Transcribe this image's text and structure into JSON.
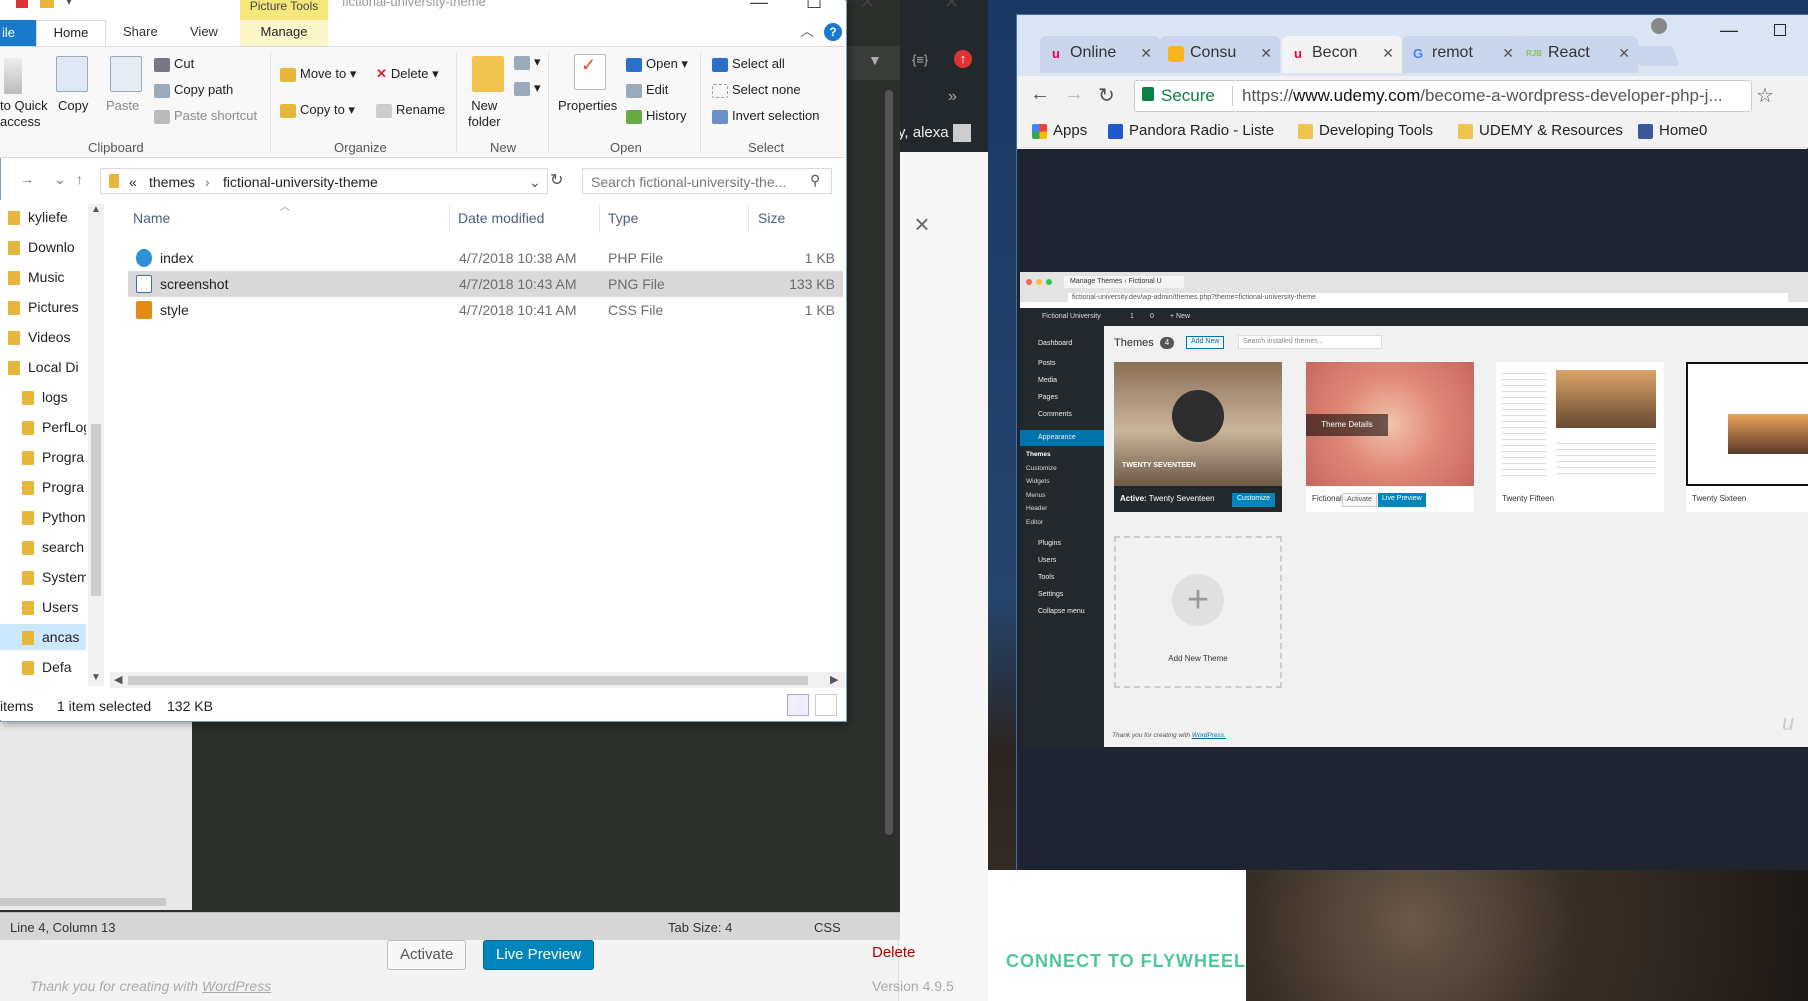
{
  "wp": {
    "user": "y, alexa",
    "activate": "Activate",
    "live_preview": "Live Preview",
    "delete": "Delete",
    "thanks_prefix": "Thank you for creating with ",
    "thanks_link": "WordPress",
    "version": "Version 4.9.5",
    "close": "×"
  },
  "editor": {
    "cursor": "Line 4, Column 13",
    "tab_size": "Tab Size: 4",
    "mode": "CSS"
  },
  "explorer": {
    "picture_tools": "Picture Tools",
    "title": "fictional-university-theme",
    "tabs": {
      "file": "ile",
      "home": "Home",
      "share": "Share",
      "view": "View",
      "manage": "Manage"
    },
    "ribbon": {
      "clipboard": {
        "group": "Clipboard",
        "pin": "to Quick\naccess",
        "copy": "Copy",
        "paste": "Paste",
        "cut": "Cut",
        "copy_path": "Copy path",
        "paste_shortcut": "Paste shortcut"
      },
      "organize": {
        "group": "Organize",
        "move_to": "Move to",
        "copy_to": "Copy to",
        "delete": "Delete",
        "rename": "Rename"
      },
      "new": {
        "group": "New",
        "new_folder": "New\nfolder"
      },
      "open": {
        "group": "Open",
        "properties": "Properties",
        "open": "Open",
        "edit": "Edit",
        "history": "History"
      },
      "select": {
        "group": "Select",
        "select_all": "Select all",
        "select_none": "Select none",
        "invert": "Invert selection"
      }
    },
    "breadcrumb": {
      "chev": "«",
      "part1": "themes",
      "part2": "fictional-university-theme"
    },
    "search_placeholder": "Search fictional-university-the...",
    "tree": [
      {
        "label": "kyliefe"
      },
      {
        "label": "Downlo"
      },
      {
        "label": "Music"
      },
      {
        "label": "Pictures"
      },
      {
        "label": "Videos"
      },
      {
        "label": "Local Di"
      },
      {
        "label": "logs"
      },
      {
        "label": "PerfLog"
      },
      {
        "label": "Progra"
      },
      {
        "label": "Progra"
      },
      {
        "label": "Python"
      },
      {
        "label": "search"
      },
      {
        "label": "System"
      },
      {
        "label": "Users"
      },
      {
        "label": "ancas"
      },
      {
        "label": "Defa"
      }
    ],
    "columns": {
      "name": "Name",
      "date": "Date modified",
      "type": "Type",
      "size": "Size"
    },
    "files": [
      {
        "name": "index",
        "date": "4/7/2018 10:38 AM",
        "type": "PHP File",
        "size": "1 KB"
      },
      {
        "name": "screenshot",
        "date": "4/7/2018 10:43 AM",
        "type": "PNG File",
        "size": "133 KB"
      },
      {
        "name": "style",
        "date": "4/7/2018 10:41 AM",
        "type": "CSS File",
        "size": "1 KB"
      }
    ],
    "status": {
      "items": "items",
      "selected": "1 item selected",
      "size": "132 KB"
    }
  },
  "chrome": {
    "tabs": [
      {
        "label": "Online"
      },
      {
        "label": "Consu"
      },
      {
        "label": "Becon"
      },
      {
        "label": "remot"
      },
      {
        "label": "React"
      }
    ],
    "secure": "Secure",
    "url_prefix": "https://",
    "url_host": "www.udemy.com",
    "url_path": "/become-a-wordpress-developer-php-j...",
    "bookmarks": [
      {
        "label": "Apps"
      },
      {
        "label": "Pandora Radio - Liste"
      },
      {
        "label": "Developing Tools"
      },
      {
        "label": "UDEMY & Resources"
      },
      {
        "label": "Home0"
      }
    ]
  },
  "video": {
    "tab": "Manage Themes ‹ Fictional U",
    "url": "fictional-university.dev/wp-admin/themes.php?theme=fictional-university-theme",
    "admin_site": "Fictional University",
    "admin_counts": "1",
    "admin_comments": "0",
    "admin_new": "+ New",
    "sidebar": [
      "Dashboard",
      "Posts",
      "Media",
      "Pages",
      "Comments",
      "Appearance",
      "Plugins",
      "Users",
      "Tools",
      "Settings",
      "Collapse menu"
    ],
    "appearance_sub": [
      "Themes",
      "Customize",
      "Widgets",
      "Menus",
      "Header",
      "Editor"
    ],
    "heading": "Themes",
    "count": "4",
    "add_new": "Add New",
    "search_placeholder": "Search installed themes...",
    "theme1_active": "Active:",
    "theme1_name": "Twenty Seventeen",
    "theme1_banner": "TWENTY SEVENTEEN",
    "customize": "Customize",
    "theme2_name": "Fictional Univers",
    "theme_details": "Theme Details",
    "activate": "Activate",
    "live_preview": "Live Preview",
    "theme3_name": "Twenty Fifteen",
    "theme4_name": "Twenty Sixteen",
    "add_theme": "Add New Theme",
    "thanks": "Thank you for creating with ",
    "thanks_link": "WordPress."
  },
  "flywheel": {
    "cta": "CONNECT TO FLYWHEEL"
  }
}
